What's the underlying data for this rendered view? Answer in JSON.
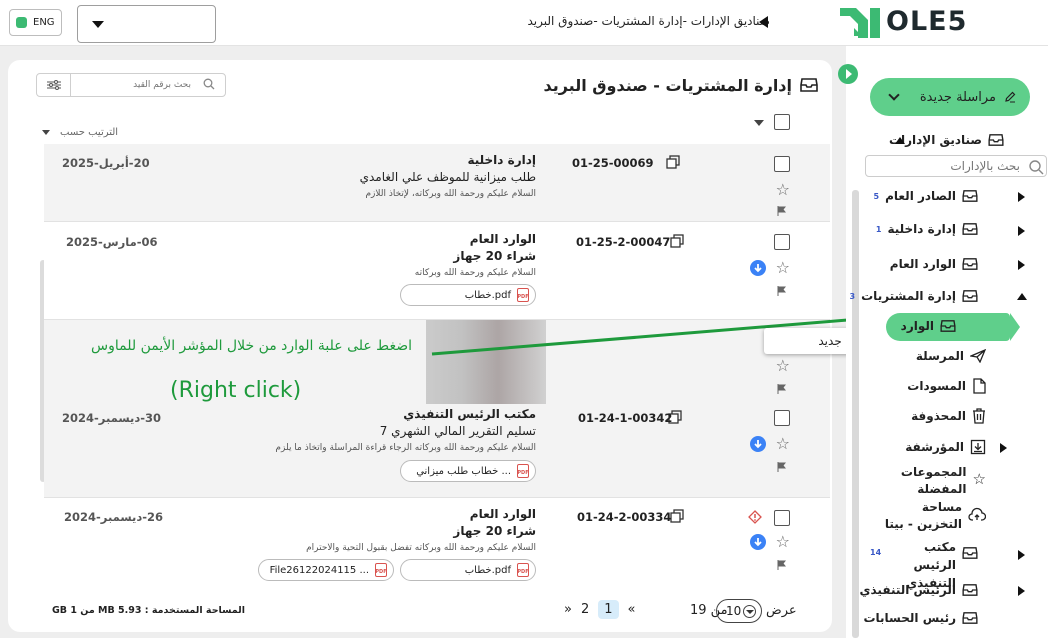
{
  "topbar": {
    "lang": "ENG",
    "breadcrumb": "صناديق الإدارات  -إدارة المشتريات -صندوق البريد",
    "logo_text": "OLE5",
    "logo_color": "#3cba73"
  },
  "main": {
    "title": "إدارة المشتريات - صندوق البريد",
    "search_placeholder": "بحث برقم القيد",
    "sort_label": "الترتيب حسب"
  },
  "messages": [
    {
      "ref": "01-25-00069",
      "dept": "إدارة داخلية",
      "subject": "طلب ميزانية للموظف علي الغامدي",
      "body": "السلام عليكم ورحمة الله وبركاته، لإتخاذ اللازم",
      "date": "20-أبريل-2025",
      "attachments": []
    },
    {
      "ref": "01-25-2-00047",
      "dept": "الوارد العام",
      "subject": "شراء 20 جهاز",
      "body": "السلام عليكم ورحمة الله وبركاته",
      "date": "06-مارس-2025",
      "attachments": [
        "خطاب.pdf"
      ]
    },
    {
      "ref": "01-24-1-00342",
      "dept": "مكتب الرئيس التنفيذي",
      "subject": "تسليم التقرير المالي الشهري 7",
      "body": "السلام عليكم ورحمة الله وبركاته الرجاء قراءة المراسلة واتخاذ ما يلزم",
      "date": "30-ديسمبر-2024",
      "attachments": [
        "خطاب طلب ميزاني ..."
      ]
    },
    {
      "ref": "01-24-2-00334",
      "dept": "الوارد العام",
      "subject": "شراء 20 جهاز",
      "body": "السلام عليكم ورحمة الله وبركاته تفضل بقبول التحية والاحترام",
      "date": "26-ديسمبر-2024",
      "attachments": [
        "خطاب.pdf",
        "File26122024115 ..."
      ]
    }
  ],
  "annotation": {
    "arabic": "اضغط على علبة الوارد من خلال المؤشر الأيمن للماوس",
    "english": "(Right click)",
    "color": "#1e9a3c"
  },
  "context_menu": {
    "new_folder": "مجلد جديد"
  },
  "footer": {
    "storage": "المساحة المستخدمة : 5.93 MB من 1 GB",
    "per_page_label": "عرض",
    "per_page": "10",
    "of_label": "من 19",
    "pages": [
      "1",
      "2"
    ],
    "first": "«",
    "last": "»"
  },
  "sidebar": {
    "new_button": "مراسلة جديدة",
    "dept_boxes": "صناديق الإدارات",
    "search_placeholder": "بحث بالإدارات",
    "items": [
      {
        "label": "الصادر العام",
        "badge": "5"
      },
      {
        "label": "إدارة داخلية",
        "badge": "1"
      },
      {
        "label": "الوارد العام",
        "badge": ""
      },
      {
        "label": "إدارة المشتريات",
        "badge": "3"
      }
    ],
    "subitems": {
      "inbox": "الوارد",
      "sent": "المرسلة",
      "drafts": "المسودات",
      "deleted": "المحذوفة",
      "archived": "المؤرشفة",
      "fav_groups": "المجموعات المفضلة",
      "storage": "مساحة التخزين - بيتا"
    },
    "more": [
      {
        "label": "مكتب الرئيس التنفيذي",
        "badge": "14"
      },
      {
        "label": "الرئيس التنفيذي",
        "badge": ""
      },
      {
        "label": "رئيس الحسابات",
        "badge": ""
      }
    ]
  }
}
